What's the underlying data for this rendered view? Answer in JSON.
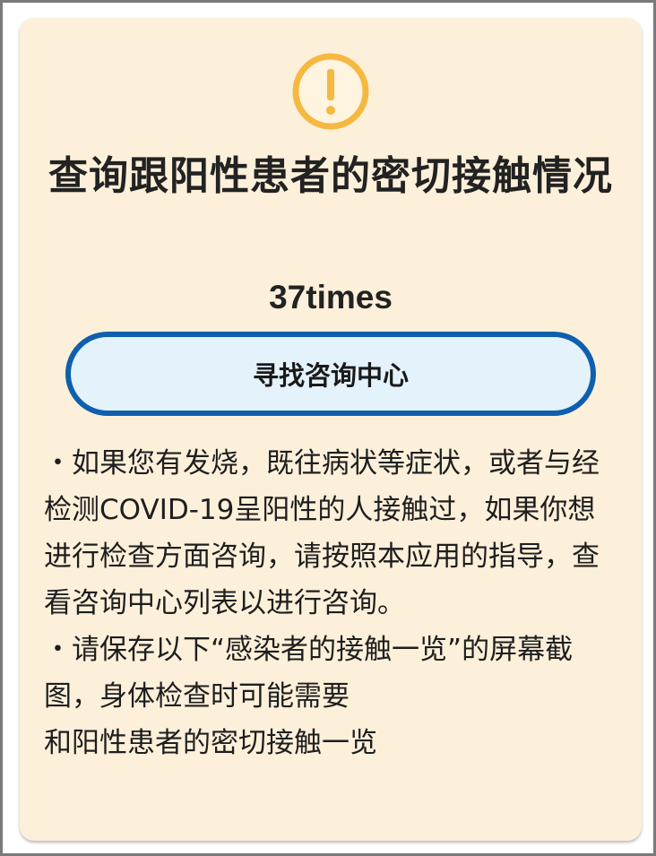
{
  "card": {
    "icon": "exclamation-circle-icon",
    "title": "查询跟阳性患者的密切接触情况",
    "count": "37times",
    "consult_button_label": "寻找咨询中心",
    "notes": [
      "・如果您有发烧，既往病状等症状，或者与经检测COVID-19呈阳性的人接触过，如果你想进行检查方面咨询，请按照本应用的指导，查看咨询中心列表以进行咨询。",
      "・请保存以下“感染者的接触一览”的屏幕截图，身体检查时可能需要",
      "和阳性患者的密切接触一览"
    ]
  },
  "colors": {
    "card_background": "#fdf0da",
    "icon_accent": "#f5b840",
    "button_border": "#0f5fae",
    "button_fill": "#e4f2fc",
    "text": "#222222"
  }
}
